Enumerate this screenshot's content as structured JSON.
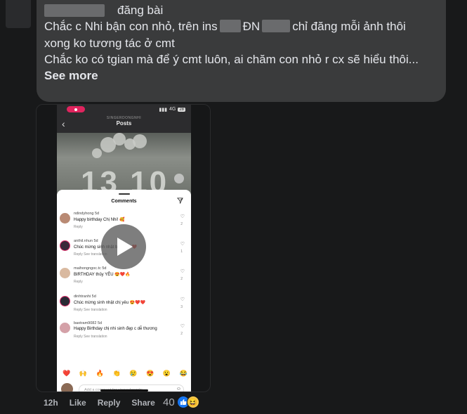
{
  "comment": {
    "header_suffix": "đăng bài",
    "line1_a": "Chắc c Nhi bận con nhỏ, trên ins",
    "line1_b": "ĐN",
    "line1_c": "chỉ đăng mỗi ảnh thôi",
    "line2": "xong ko tương tác ở cmt",
    "line3": "Chắc ko có tgian mà để ý cmt luôn, ai chăm con nhỏ r cx sẽ hiểu thôi...",
    "see_more": "See more"
  },
  "video": {
    "status_network": "4G",
    "status_battery": "28",
    "ig_username": "SINGERDONGNHI",
    "ig_title": "Posts",
    "photo_number": "13 10",
    "sheet_title": "Comments",
    "comments": [
      {
        "user": "ndindyhong 5d",
        "text": "Happy birthday Chị Nhi! 🥰",
        "meta": "Reply",
        "likes": "2",
        "avatar_color": "#b98a74"
      },
      {
        "user": "anthil.nhun 5d",
        "text": "Chúc mừng sinh nhật bé Sai a ❤️",
        "meta": "Reply    See translation",
        "likes": "1",
        "avatar_color": "#3b2a3a"
      },
      {
        "user": "maihongngoc.tc 5d",
        "text": "BIRTHDAY thủy YÊU 😍❤️🔥",
        "meta": "Reply",
        "likes": "2",
        "avatar_color": "#d9b9a0"
      },
      {
        "user": "dinhtranhi 5d",
        "text": "Chúc mừng sinh nhật chị yêu 😍❤️❤️",
        "meta": "Reply    See translation",
        "likes": "3",
        "avatar_color": "#2a2a35"
      },
      {
        "user": "baotram9082 5d",
        "text": "Happy Birthday chị nhi sinh đẹp c dễ thương",
        "meta": "Reply    See translation",
        "likes": "2",
        "avatar_color": "#d4a1a8"
      }
    ],
    "emojis": [
      "❤️",
      "🙌",
      "🔥",
      "👏",
      "😢",
      "😍",
      "😮",
      "😂"
    ],
    "add_comment_placeholder": "Add a comment for singerdongnhi..."
  },
  "actions": {
    "time": "12h",
    "like": "Like",
    "reply": "Reply",
    "share": "Share",
    "reaction_count": "40"
  },
  "colors": {
    "background": "#18191a",
    "bubble": "#3a3b3c",
    "text": "#e4e6eb",
    "muted": "#b0b3b8",
    "like_blue": "#1877f2"
  }
}
